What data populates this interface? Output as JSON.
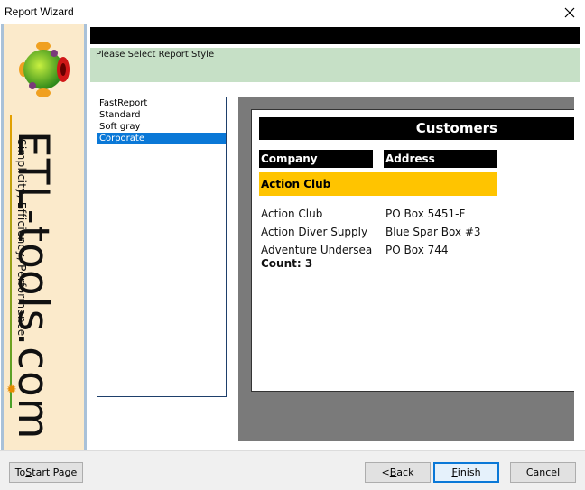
{
  "window": {
    "title": "Report Wizard",
    "close_label": "✕"
  },
  "sidebar": {
    "brand": "ETL-tools.com",
    "tagline": "Simplicity, Efficiency, Performance",
    "flower_icon": "✹"
  },
  "header": {
    "instruction": "Please Select Report Style"
  },
  "styles": {
    "items": [
      "FastReport",
      "Standard",
      "Soft gray",
      "Corporate"
    ],
    "selected": "Corporate"
  },
  "preview": {
    "title": "Customers",
    "columns": [
      "Company",
      "Address"
    ],
    "group": "Action Club",
    "rows": [
      {
        "company": "Action Club",
        "address": "PO Box 5451-F"
      },
      {
        "company": "Action Diver Supply",
        "address": "Blue Spar Box #3"
      },
      {
        "company": "Adventure Undersea",
        "address": "PO Box 744"
      }
    ],
    "count_label": "Count: 3"
  },
  "footer": {
    "start_pre": "To ",
    "start_key": "S",
    "start_post": "tart Page",
    "back_pre": "< ",
    "back_key": "B",
    "back_post": "ack",
    "finish_pre": "",
    "finish_key": "F",
    "finish_post": "inish",
    "cancel_label": "Cancel"
  },
  "colors": {
    "accent": "#0a78d7",
    "header_green": "#c6e0c6",
    "sidebar_bg": "#fbeacb",
    "group_band": "#ffc400",
    "preview_bg": "#7a7a7a"
  }
}
